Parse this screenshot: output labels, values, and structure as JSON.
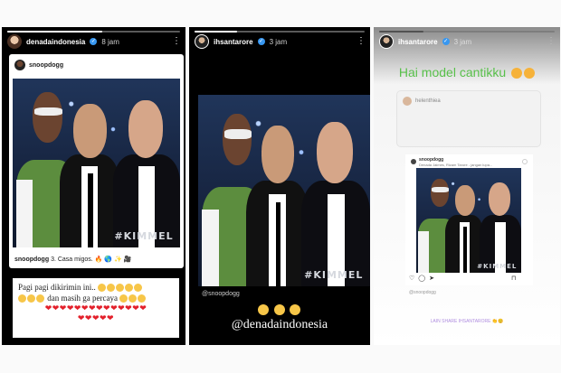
{
  "panels": {
    "left": {
      "username": "denadaindonesia",
      "time": "8 jam",
      "card_username": "snoopdogg",
      "caption_user": "snoopdogg",
      "caption_text": "3. Casa migos. 🔥 🌎 ✨ 🎥",
      "watermark": "#KIMMEL",
      "message_line1": "Pagi pagi dikirimin ini..",
      "message_line2": "dan masih ga percaya",
      "hearts_row": "❤❤❤❤❤❤❤❤❤❤❤❤❤❤",
      "hearts_row2": "❤❤❤❤❤"
    },
    "middle": {
      "username": "ihsantarore",
      "time": "3 jam",
      "credit": "@snoopdogg",
      "watermark": "#KIMMEL",
      "mention": "@denadaindonesia"
    },
    "right": {
      "username": "ihsantarore",
      "time": "3 jam",
      "greeting": "Hai model cantikku",
      "mini_user": "helenthiea",
      "post_user": "snoopdogg",
      "post_caption": "Denada Jaimes, Rizam Tarore - jangan lupa...",
      "watermark": "#KIMMEL",
      "likes": "@snoopdogg",
      "share_text": "LAIN SHARE IHSANTARORE 👏😊"
    }
  },
  "progress": {
    "left": 0.55,
    "middle": 0.25,
    "right": 0.25
  }
}
